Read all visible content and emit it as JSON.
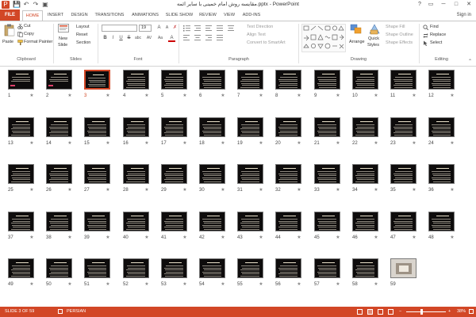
{
  "window": {
    "title": "مقایسه روش امام خمینی با سایر ائمه.pptx - PowerPoint",
    "controls": {
      "help": "?",
      "restore": "▭",
      "minimize": "─",
      "maximize": "□",
      "close": "✕"
    }
  },
  "quick_access": {
    "save": "💾",
    "undo": "↶",
    "redo": "↷",
    "start": "▣"
  },
  "tabs": [
    {
      "label": "HOME",
      "active": true
    },
    {
      "label": "INSERT"
    },
    {
      "label": "DESIGN"
    },
    {
      "label": "TRANSITIONS"
    },
    {
      "label": "ANIMATIONS"
    },
    {
      "label": "SLIDE SHOW"
    },
    {
      "label": "REVIEW"
    },
    {
      "label": "VIEW"
    },
    {
      "label": "ADD-INS"
    }
  ],
  "file_tab": "FILE",
  "signin": "Sign in",
  "ribbon": {
    "clipboard": {
      "label": "Clipboard",
      "paste": "Paste",
      "cut": "Cut",
      "copy": "Copy",
      "format_painter": "Format Painter"
    },
    "slides": {
      "label": "Slides",
      "new_slide": "New",
      "new_slide_2": "Slide",
      "layout": "Layout",
      "reset": "Reset",
      "section": "Section"
    },
    "font": {
      "label": "Font",
      "font_name": "",
      "font_size": "19",
      "bold": "B",
      "italic": "I",
      "underline": "U",
      "strike": "S",
      "shadow": "abc",
      "spacing": "AV",
      "case": "Aa",
      "color": "A"
    },
    "paragraph": {
      "label": "Paragraph",
      "text_direction": "Text Direction",
      "align_text": "Align Text",
      "smartart": "Convert to SmartArt"
    },
    "drawing": {
      "label": "Drawing",
      "arrange": "Arrange",
      "quick_styles": "Quick",
      "quick_styles_2": "Styles",
      "shape_fill": "Shape Fill",
      "shape_outline": "Shape Outline",
      "shape_effects": "Shape Effects"
    },
    "editing": {
      "label": "Editing",
      "find": "Find",
      "replace": "Replace",
      "select": "Select"
    }
  },
  "slides": {
    "count": 59,
    "selected": 3,
    "star_glyph": "★"
  },
  "status": {
    "slide_info": "SLIDE 3 OF 59",
    "language": "PERSIAN",
    "zoom_minus": "−",
    "zoom_plus": "+",
    "zoom": "38%",
    "zoom_level": 0.38
  },
  "colors": {
    "accent": "#d24726",
    "slide_bg": "#0e0c0c"
  }
}
